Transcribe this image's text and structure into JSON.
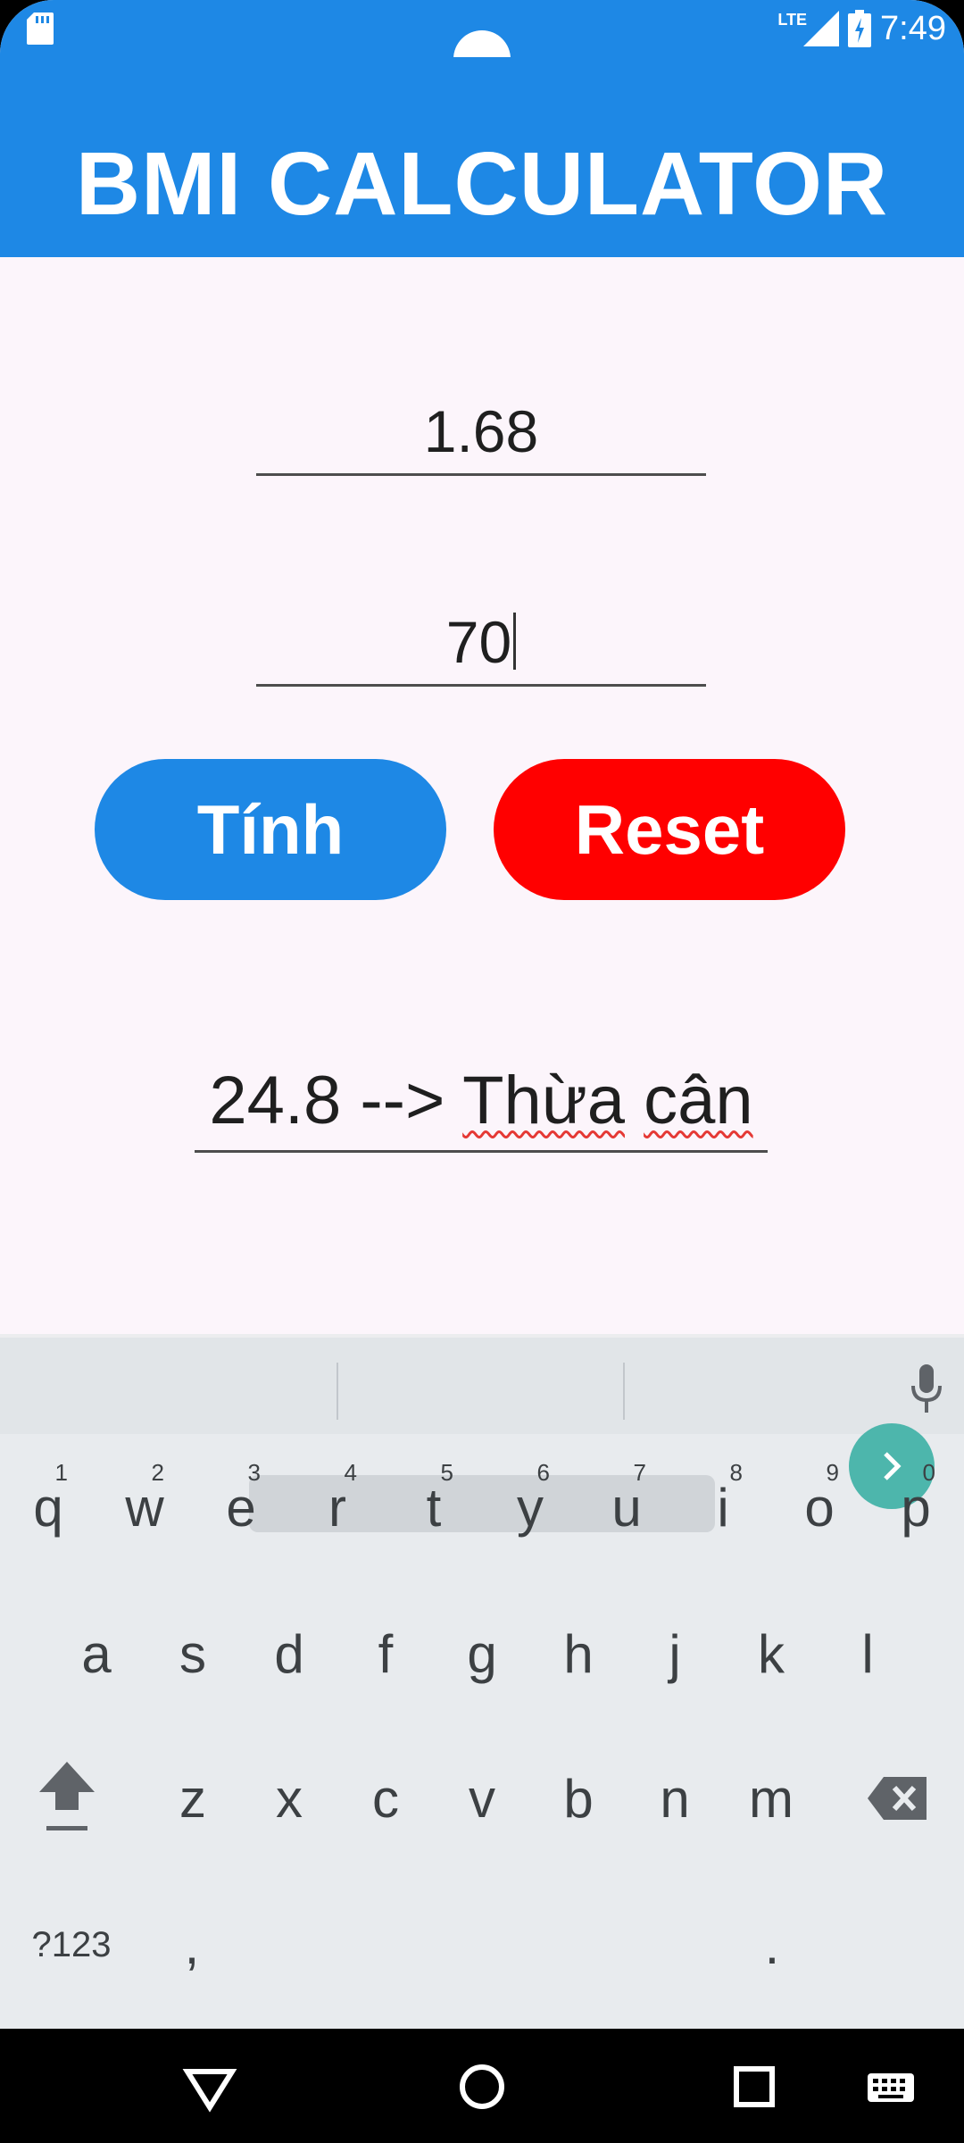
{
  "status_bar": {
    "time": "7:49",
    "network": "LTE"
  },
  "app_bar": {
    "title": "BMI CALCULATOR"
  },
  "form": {
    "height_value": "1.68",
    "weight_value": "70",
    "calc_button": "Tính",
    "reset_button": "Reset"
  },
  "result": {
    "prefix": "24.8 --> ",
    "word1": "Thừa",
    "word2": "cân"
  },
  "keyboard": {
    "row1": [
      {
        "k": "q",
        "n": "1"
      },
      {
        "k": "w",
        "n": "2"
      },
      {
        "k": "e",
        "n": "3"
      },
      {
        "k": "r",
        "n": "4"
      },
      {
        "k": "t",
        "n": "5"
      },
      {
        "k": "y",
        "n": "6"
      },
      {
        "k": "u",
        "n": "7"
      },
      {
        "k": "i",
        "n": "8"
      },
      {
        "k": "o",
        "n": "9"
      },
      {
        "k": "p",
        "n": "0"
      }
    ],
    "row2": [
      "a",
      "s",
      "d",
      "f",
      "g",
      "h",
      "j",
      "k",
      "l"
    ],
    "row3": [
      "z",
      "x",
      "c",
      "v",
      "b",
      "n",
      "m"
    ],
    "symbols": "?123",
    "comma": ",",
    "period": "."
  },
  "colors": {
    "primary": "#1e88e5",
    "reset": "#ff0000",
    "enter": "#4db6ac"
  }
}
